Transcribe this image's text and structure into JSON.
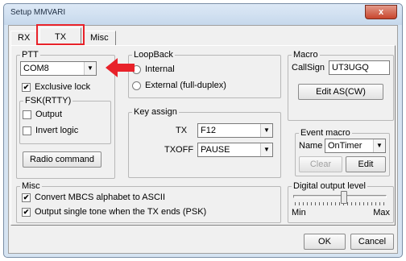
{
  "window": {
    "title": "Setup MMVARI",
    "close_glyph": "x"
  },
  "tabs": [
    {
      "label": "RX"
    },
    {
      "label": "TX"
    },
    {
      "label": "Misc"
    }
  ],
  "ptt": {
    "group_label": "PTT",
    "port_value": "COM8",
    "exclusive_lock_label": "Exclusive lock",
    "exclusive_lock_checked": true,
    "fsk": {
      "group_label": "FSK(RTTY)",
      "output_label": "Output",
      "invert_logic_label": "Invert logic"
    },
    "radio_command_label": "Radio command"
  },
  "loopback": {
    "group_label": "LoopBack",
    "internal_label": "Internal",
    "external_label": "External (full-duplex)"
  },
  "key_assign": {
    "group_label": "Key assign",
    "tx_label": "TX",
    "tx_value": "F12",
    "txoff_label": "TXOFF",
    "txoff_value": "PAUSE"
  },
  "macro": {
    "group_label": "Macro",
    "callsign_label": "CallSign",
    "callsign_value": "UT3UGQ",
    "edit_as_cw_label": "Edit AS(CW)"
  },
  "event_macro": {
    "group_label": "Event macro",
    "name_label": "Name",
    "name_value": "OnTimer",
    "clear_label": "Clear",
    "edit_label": "Edit"
  },
  "misc": {
    "group_label": "Misc",
    "convert_mbcs_label": "Convert MBCS alphabet to ASCII",
    "single_tone_label": "Output single tone when the TX ends (PSK)"
  },
  "digital_output": {
    "group_label": "Digital output level",
    "min_label": "Min",
    "max_label": "Max",
    "level_fraction": 0.55
  },
  "dialog": {
    "ok_label": "OK",
    "cancel_label": "Cancel"
  },
  "icons": {
    "check_glyph": "✔",
    "dropdown_glyph": "▼"
  },
  "colors": {
    "highlight": "#e8222a",
    "window_frame": "#d6e4f2",
    "dialog_bg": "#f0f0f0"
  }
}
